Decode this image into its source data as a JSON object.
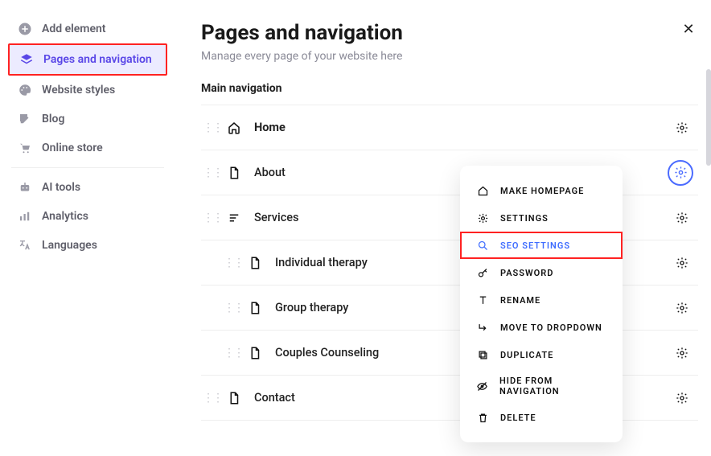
{
  "sidebar": {
    "items": [
      {
        "label": "Add element"
      },
      {
        "label": "Pages and navigation"
      },
      {
        "label": "Website styles"
      },
      {
        "label": "Blog"
      },
      {
        "label": "Online store"
      },
      {
        "label": "AI tools"
      },
      {
        "label": "Analytics"
      },
      {
        "label": "Languages"
      }
    ]
  },
  "panel": {
    "title": "Pages and navigation",
    "subtitle": "Manage every page of your website here",
    "section": "Main navigation"
  },
  "pages": [
    {
      "label": "Home",
      "bold": true
    },
    {
      "label": "About"
    },
    {
      "label": "Services"
    },
    {
      "label": "Individual therapy"
    },
    {
      "label": "Group therapy"
    },
    {
      "label": "Couples Counseling"
    },
    {
      "label": "Contact"
    }
  ],
  "menu": {
    "items": [
      {
        "label": "MAKE HOMEPAGE"
      },
      {
        "label": "SETTINGS"
      },
      {
        "label": "SEO SETTINGS"
      },
      {
        "label": "PASSWORD"
      },
      {
        "label": "RENAME"
      },
      {
        "label": "MOVE TO DROPDOWN"
      },
      {
        "label": "DUPLICATE"
      },
      {
        "label": "HIDE FROM NAVIGATION"
      },
      {
        "label": "DELETE"
      }
    ]
  }
}
